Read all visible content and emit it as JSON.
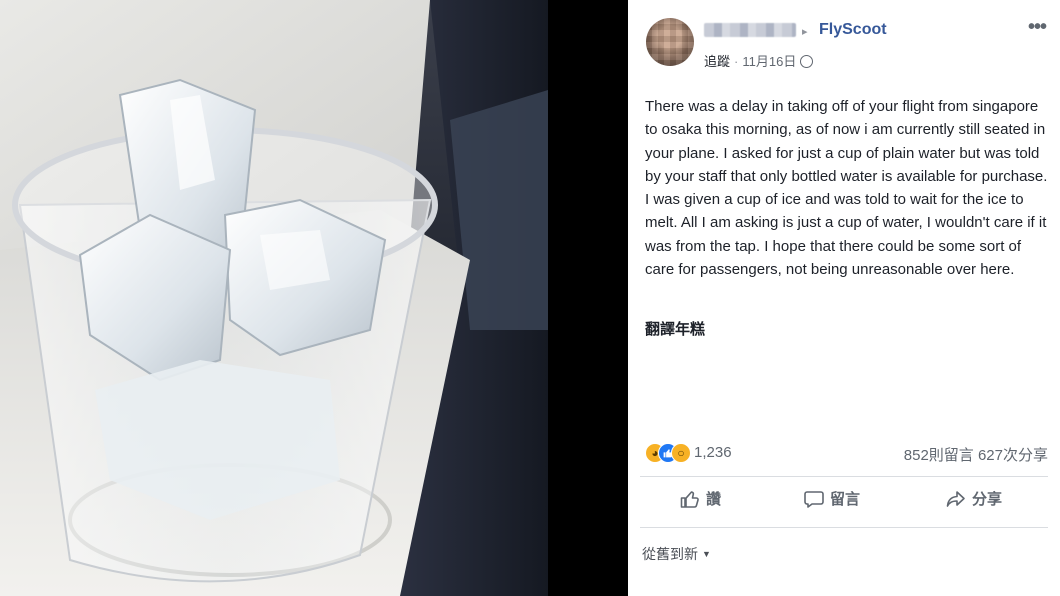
{
  "post": {
    "author_name": "",
    "arrow": "▸",
    "page_name": "FlyScoot",
    "more_icon": "•••",
    "follow_label": "追蹤",
    "separator": "·",
    "date": "11月16日",
    "body": "There was a delay in taking off of your flight from singapore to osaka this morning, as of now i am currently still seated in your plane. I asked for just a cup of plain water but was told by your staff that only bottled water is available for purchase. I was given a cup of ice and was told to wait for the ice to melt. All I am asking is just a cup of water, I wouldn't care if it was from the tap. I hope that there could be some sort of care for passengers, not being unreasonable over here.",
    "translate_label": "翻譯年糕",
    "reactions": {
      "icons": [
        "haha-icon",
        "like-icon",
        "wow-icon"
      ],
      "count": "1,236"
    },
    "comments_shares": "852則留言  627次分享",
    "actions": {
      "like_label": "讚",
      "comment_label": "留言",
      "share_label": "分享"
    },
    "sort_label": "從舊到新",
    "sort_caret": "▼"
  },
  "colors": {
    "page_link": "#365899",
    "text": "#1d2129",
    "muted": "#606770",
    "like_blue": "#2078f4",
    "reaction_yellow": "#f7b125"
  }
}
